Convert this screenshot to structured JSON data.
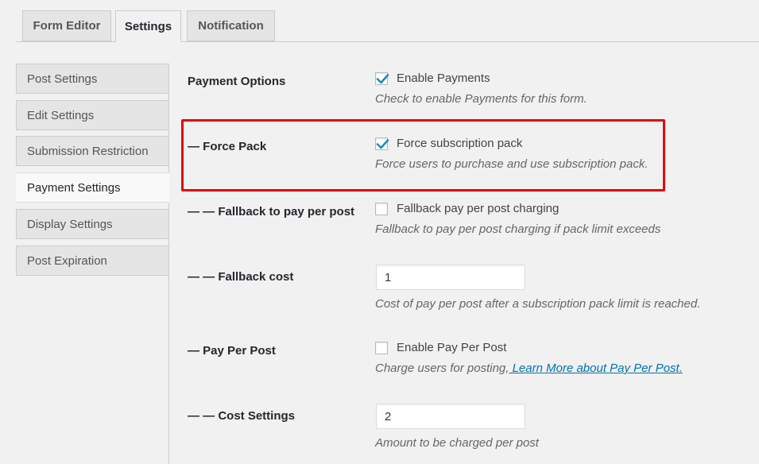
{
  "tabs": [
    {
      "label": "Form Editor",
      "active": false
    },
    {
      "label": "Settings",
      "active": true
    },
    {
      "label": "Notification",
      "active": false
    }
  ],
  "side_menu": [
    {
      "label": "Post Settings"
    },
    {
      "label": "Edit Settings"
    },
    {
      "label": "Submission Restriction"
    },
    {
      "label": "Payment Settings",
      "active": true
    },
    {
      "label": "Display Settings"
    },
    {
      "label": "Post Expiration"
    }
  ],
  "payment_options": {
    "label": "Payment Options",
    "checkbox_label": "Enable Payments",
    "checked": true,
    "description": "Check to enable Payments for this form."
  },
  "force_pack": {
    "label": "— Force Pack",
    "checkbox_label": "Force subscription pack",
    "checked": true,
    "description": "Force users to purchase and use subscription pack."
  },
  "fallback_ppp": {
    "label": "— — Fallback to pay per post",
    "checkbox_label": "Fallback pay per post charging",
    "checked": false,
    "description": "Fallback to pay per post charging if pack limit exceeds"
  },
  "fallback_cost": {
    "label": "— — Fallback cost",
    "value": "1",
    "description": "Cost of pay per post after a subscription pack limit is reached."
  },
  "pay_per_post": {
    "label": "— Pay Per Post",
    "checkbox_label": "Enable Pay Per Post",
    "checked": false,
    "description": "Charge users for posting,",
    "link_text": " Learn More about Pay Per Post."
  },
  "cost_settings": {
    "label": "— — Cost Settings",
    "value": "2",
    "description": "Amount to be charged per post"
  },
  "colors": {
    "highlight": "#e3000f",
    "link": "#0073aa",
    "check": "#1e8cbe"
  }
}
